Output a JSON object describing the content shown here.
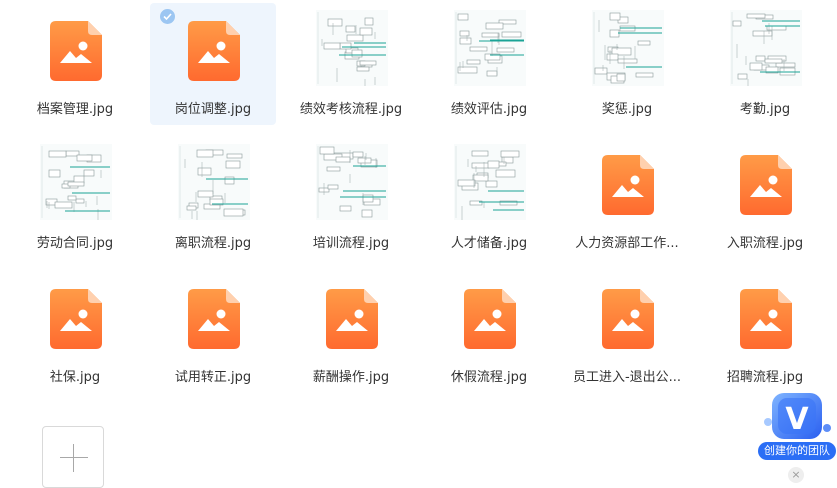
{
  "files": [
    {
      "name": "档案管理.jpg",
      "kind": "generic",
      "selected": false
    },
    {
      "name": "岗位调整.jpg",
      "kind": "generic",
      "selected": true
    },
    {
      "name": "绩效考核流程.jpg",
      "kind": "flowchart",
      "selected": false
    },
    {
      "name": "绩效评估.jpg",
      "kind": "flowchart",
      "selected": false
    },
    {
      "name": "奖惩.jpg",
      "kind": "flowchart",
      "selected": false
    },
    {
      "name": "考勤.jpg",
      "kind": "flowchart",
      "selected": false
    },
    {
      "name": "劳动合同.jpg",
      "kind": "flowchart",
      "selected": false
    },
    {
      "name": "离职流程.jpg",
      "kind": "flowchart",
      "selected": false
    },
    {
      "name": "培训流程.jpg",
      "kind": "flowchart",
      "selected": false
    },
    {
      "name": "人才储备.jpg",
      "kind": "flowchart",
      "selected": false
    },
    {
      "name": "人力资源部工作...",
      "kind": "generic",
      "selected": false
    },
    {
      "name": "入职流程.jpg",
      "kind": "generic",
      "selected": false
    },
    {
      "name": "社保.jpg",
      "kind": "generic",
      "selected": false
    },
    {
      "name": "试用转正.jpg",
      "kind": "generic",
      "selected": false
    },
    {
      "name": "薪酬操作.jpg",
      "kind": "generic",
      "selected": false
    },
    {
      "name": "休假流程.jpg",
      "kind": "generic",
      "selected": false
    },
    {
      "name": "员工进入-退出公...",
      "kind": "generic",
      "selected": false
    },
    {
      "name": "招聘流程.jpg",
      "kind": "generic",
      "selected": false
    }
  ],
  "add_button": {
    "icon": "plus-icon"
  },
  "team_badge": {
    "logo": "V",
    "label": "创建你的团队",
    "close": "×"
  },
  "colors": {
    "icon_top": "#ff9b47",
    "icon_bottom": "#ff6a2f",
    "selected_bg": "#eef5fd",
    "check": "#9cc6f2",
    "teal": "#1aa396",
    "badge_blue": "#2b6ef5"
  }
}
